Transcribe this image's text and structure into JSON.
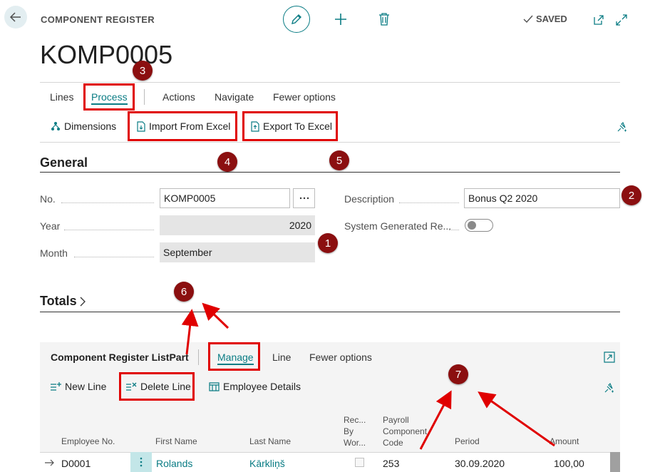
{
  "header": {
    "caption": "COMPONENT REGISTER",
    "record_no": "KOMP0005",
    "saved_label": "SAVED"
  },
  "action_bar": {
    "menus": [
      "Lines",
      "Process",
      "Actions",
      "Navigate",
      "Fewer options"
    ],
    "active_menu": "Process",
    "actions": {
      "dimensions": "Dimensions",
      "import_excel": "Import From Excel",
      "export_excel": "Export To Excel"
    }
  },
  "general": {
    "title": "General",
    "fields": {
      "no_label": "No.",
      "no_value": "KOMP0005",
      "year_label": "Year",
      "year_value": "2020",
      "month_label": "Month",
      "month_value": "September",
      "description_label": "Description",
      "description_value": "Bonus Q2 2020",
      "system_generated_label": "System Generated Re...",
      "system_generated_on": false
    }
  },
  "totals": {
    "title": "Totals"
  },
  "listpart": {
    "title": "Component Register ListPart",
    "menus": [
      "Manage",
      "Line",
      "Fewer options"
    ],
    "active_menu": "Manage",
    "actions": {
      "new_line": "New Line",
      "delete_line": "Delete Line",
      "employee_details": "Employee Details"
    },
    "columns": {
      "employee_no": "Employee No.",
      "first_name": "First Name",
      "last_name": "Last Name",
      "rec_by_wor_1": "Rec...",
      "rec_by_wor_2": "By",
      "rec_by_wor_3": "Wor...",
      "payroll_1": "Payroll",
      "payroll_2": "Component",
      "payroll_3": "Code",
      "period": "Period",
      "amount": "Amount"
    },
    "rows": [
      {
        "employee_no": "D0001",
        "first_name": "Rolands",
        "last_name": "Kārkliņš",
        "payroll_code": "253",
        "period": "30.09.2020",
        "amount": "100,00"
      }
    ]
  },
  "callouts": [
    "1",
    "2",
    "3",
    "4",
    "5",
    "6",
    "7"
  ],
  "colors": {
    "accent": "#0a7c84",
    "highlight": "#e00000",
    "badge": "#8b0f10"
  }
}
